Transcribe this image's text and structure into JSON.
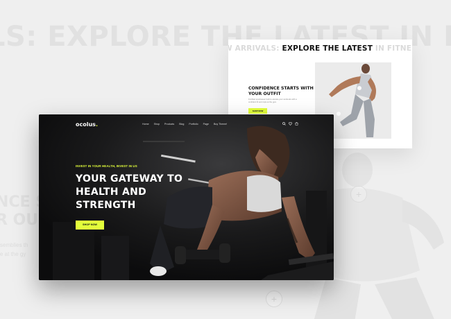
{
  "background": {
    "headline_prefix": "LS: ",
    "headline_main": "EXPLORE THE LATEST",
    "headline_suffix": " IN F",
    "headline_tail": "I",
    "side_big_1": "NCE S",
    "side_big_2": "R OU",
    "side_small_1": "semblies th",
    "side_small_2": "e at the gy"
  },
  "back_window": {
    "marquee_prefix": "W ARRIVALS: ",
    "marquee_main": "EXPLORE THE LATEST",
    "marquee_suffix": " IN FITNESS",
    "heading": "CONFIDENCE STARTS WITH YOUR OUTFIT",
    "description": "Fortified sportswear built to elevate your workouts with a confident fit and style at the gym.",
    "button": "SHOP NOW"
  },
  "front_window": {
    "logo": "ocolus",
    "logo_dot": ".",
    "nav": [
      "Home",
      "Shop",
      "Products",
      "Blog",
      "Portfolio",
      "Page",
      "Buy Theme!"
    ],
    "icons": [
      "search-icon",
      "heart-icon",
      "cart-icon"
    ],
    "eyebrow": "INVEST IN YOUR HEALTH, INVEST IN US",
    "title": "YOUR GATEWAY TO HEALTH AND STRENGTH",
    "button": "SHOP NOW"
  },
  "colors": {
    "accent": "#e3ff3b",
    "dark_bg": "#0f0f10",
    "page_bg": "#efefef"
  }
}
